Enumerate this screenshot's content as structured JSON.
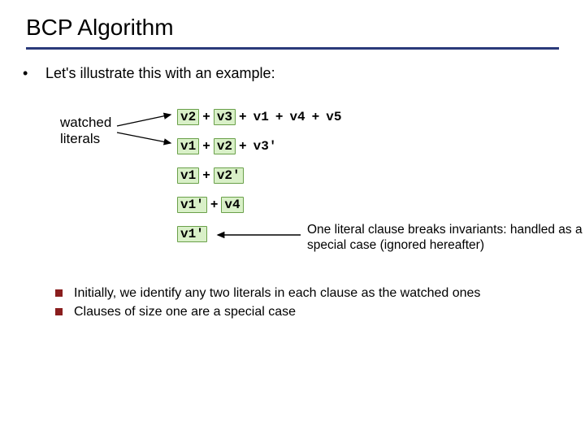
{
  "title": "BCP Algorithm",
  "intro": "Let's illustrate this with an example:",
  "watched_label_line1": "watched",
  "watched_label_line2": "literals",
  "clauses": {
    "c1": {
      "l0": "v2",
      "l1": "v3",
      "l2": "v1",
      "l3": "v4",
      "l4": "v5"
    },
    "c2": {
      "l0": "v1",
      "l1": "v2",
      "l2": "v3'"
    },
    "c3": {
      "l0": "v1",
      "l1": "v2'"
    },
    "c4": {
      "l0": "v1'",
      "l1": "v4"
    },
    "c5": {
      "l0": "v1'"
    }
  },
  "plus": "+",
  "annotation": "One literal clause breaks invariants: handled as a special case (ignored hereafter)",
  "footnotes": {
    "f1": "Initially, we identify any two literals in each clause as the watched ones",
    "f2": "Clauses of size one are a special case"
  }
}
